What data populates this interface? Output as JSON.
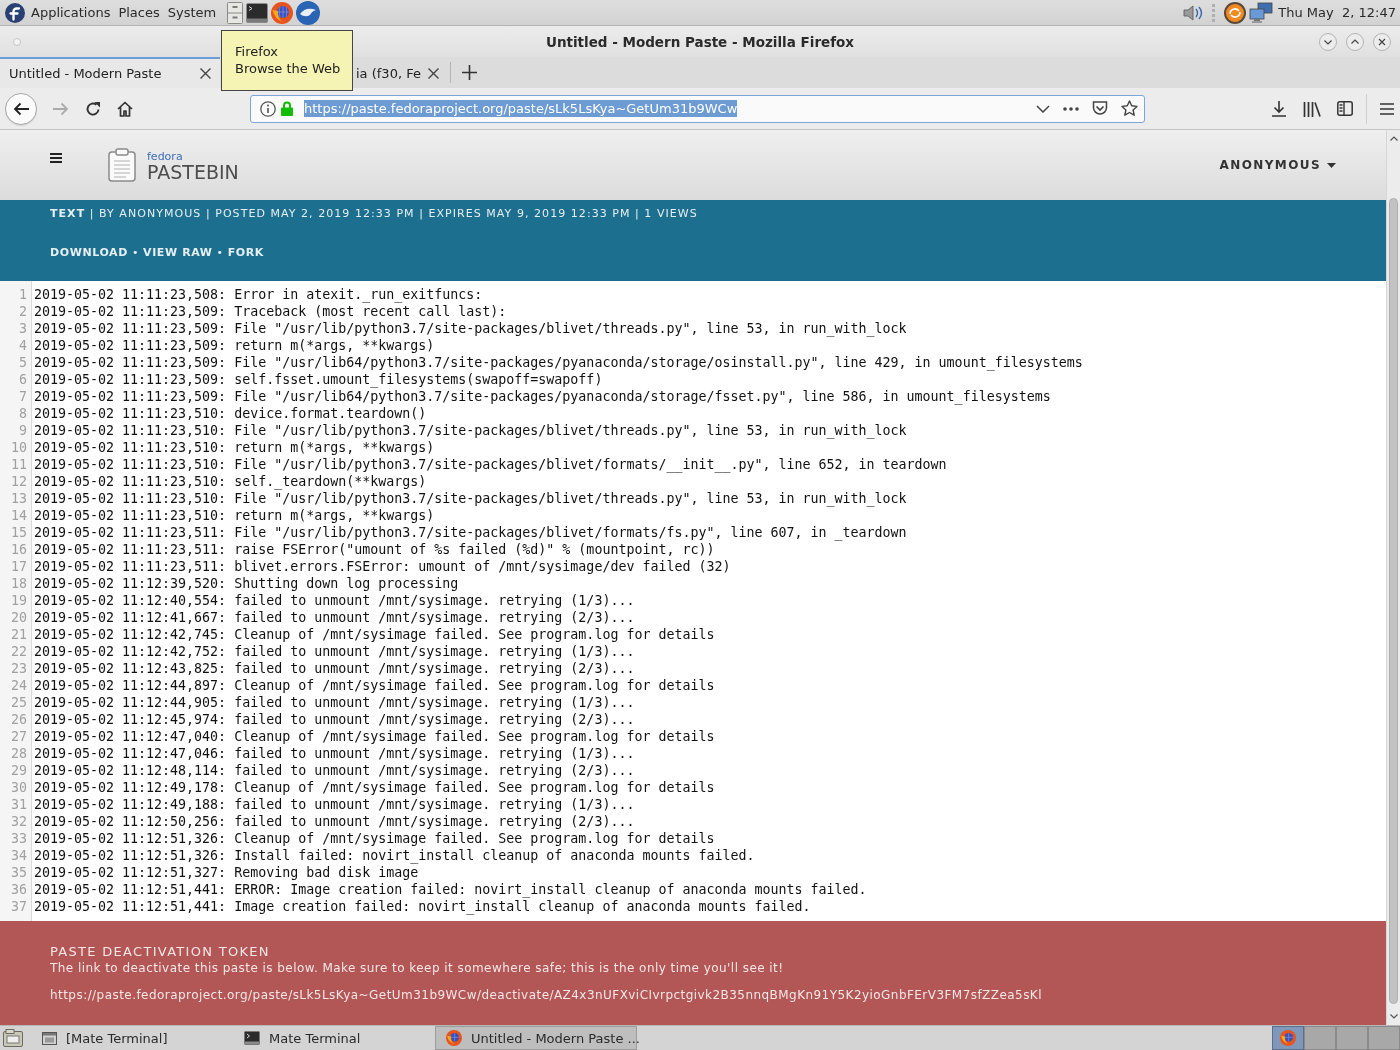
{
  "top_panel": {
    "menus": [
      "Applications",
      "Places",
      "System"
    ],
    "clock": "Thu May  2, 12:47"
  },
  "window": {
    "title": "Untitled - Modern Paste - Mozilla Firefox"
  },
  "tabs": [
    {
      "label": "Untitled - Modern Paste",
      "selected": true
    },
    {
      "label": "ia (f30, Fe",
      "selected": false
    }
  ],
  "tooltip": {
    "title": "Firefox",
    "text": "Browse the Web"
  },
  "navigation": [
    {
      "kind": "back",
      "disabled": false
    },
    {
      "kind": "forward",
      "disabled": true
    },
    {
      "kind": "reload",
      "disabled": false
    },
    {
      "kind": "home",
      "disabled": false
    }
  ],
  "address_bar": {
    "value": "https://paste.fedoraproject.org/paste/sLk5LsKya~GetUm31b9WCw",
    "selected": true
  },
  "page": {
    "header": {
      "brand": "fedora",
      "product": "PASTEBIN",
      "user_menu": "ANONYMOUS"
    },
    "meta": "**TEXT** | BY ANONYMOUS | POSTED MAY 2, 2019 12:33 PM | EXPIRES MAY 9, 2019 12:33 PM | 1 VIEWS",
    "actions": [
      {
        "kind": "link",
        "text": "DOWNLOAD"
      },
      {
        "kind": "separator",
        "text": "•"
      },
      {
        "kind": "link",
        "text": "VIEW RAW"
      },
      {
        "kind": "separator",
        "text": "•"
      },
      {
        "kind": "link",
        "text": "FORK"
      }
    ],
    "lines": [
      {
        "number": "1",
        "text": "2019-05-02 11:11:23,508: Error in atexit._run_exitfuncs:"
      },
      {
        "number": "2",
        "text": "2019-05-02 11:11:23,509: Traceback (most recent call last):"
      },
      {
        "number": "3",
        "text": "2019-05-02 11:11:23,509: File \"/usr/lib/python3.7/site-packages/blivet/threads.py\", line 53, in run_with_lock"
      },
      {
        "number": "4",
        "text": "2019-05-02 11:11:23,509: return m(*args, **kwargs)"
      },
      {
        "number": "5",
        "text": "2019-05-02 11:11:23,509: File \"/usr/lib64/python3.7/site-packages/pyanaconda/storage/osinstall.py\", line 429, in umount_filesystems"
      },
      {
        "number": "6",
        "text": "2019-05-02 11:11:23,509: self.fsset.umount_filesystems(swapoff=swapoff)"
      },
      {
        "number": "7",
        "text": "2019-05-02 11:11:23,509: File \"/usr/lib64/python3.7/site-packages/pyanaconda/storage/fsset.py\", line 586, in umount_filesystems"
      },
      {
        "number": "8",
        "text": "2019-05-02 11:11:23,510: device.format.teardown()"
      },
      {
        "number": "9",
        "text": "2019-05-02 11:11:23,510: File \"/usr/lib/python3.7/site-packages/blivet/threads.py\", line 53, in run_with_lock"
      },
      {
        "number": "10",
        "text": "2019-05-02 11:11:23,510: return m(*args, **kwargs)"
      },
      {
        "number": "11",
        "text": "2019-05-02 11:11:23,510: File \"/usr/lib/python3.7/site-packages/blivet/formats/__init__.py\", line 652, in teardown"
      },
      {
        "number": "12",
        "text": "2019-05-02 11:11:23,510: self._teardown(**kwargs)"
      },
      {
        "number": "13",
        "text": "2019-05-02 11:11:23,510: File \"/usr/lib/python3.7/site-packages/blivet/threads.py\", line 53, in run_with_lock"
      },
      {
        "number": "14",
        "text": "2019-05-02 11:11:23,510: return m(*args, **kwargs)"
      },
      {
        "number": "15",
        "text": "2019-05-02 11:11:23,511: File \"/usr/lib/python3.7/site-packages/blivet/formats/fs.py\", line 607, in _teardown"
      },
      {
        "number": "16",
        "text": "2019-05-02 11:11:23,511: raise FSError(\"umount of %s failed (%d)\" % (mountpoint, rc))"
      },
      {
        "number": "17",
        "text": "2019-05-02 11:11:23,511: blivet.errors.FSError: umount of /mnt/sysimage/dev failed (32)"
      },
      {
        "number": "18",
        "text": "2019-05-02 11:12:39,520: Shutting down log processing"
      },
      {
        "number": "19",
        "text": "2019-05-02 11:12:40,554: failed to unmount /mnt/sysimage. retrying (1/3)..."
      },
      {
        "number": "20",
        "text": "2019-05-02 11:12:41,667: failed to unmount /mnt/sysimage. retrying (2/3)..."
      },
      {
        "number": "21",
        "text": "2019-05-02 11:12:42,745: Cleanup of /mnt/sysimage failed. See program.log for details"
      },
      {
        "number": "22",
        "text": "2019-05-02 11:12:42,752: failed to unmount /mnt/sysimage. retrying (1/3)..."
      },
      {
        "number": "23",
        "text": "2019-05-02 11:12:43,825: failed to unmount /mnt/sysimage. retrying (2/3)..."
      },
      {
        "number": "24",
        "text": "2019-05-02 11:12:44,897: Cleanup of /mnt/sysimage failed. See program.log for details"
      },
      {
        "number": "25",
        "text": "2019-05-02 11:12:44,905: failed to unmount /mnt/sysimage. retrying (1/3)..."
      },
      {
        "number": "26",
        "text": "2019-05-02 11:12:45,974: failed to unmount /mnt/sysimage. retrying (2/3)..."
      },
      {
        "number": "27",
        "text": "2019-05-02 11:12:47,040: Cleanup of /mnt/sysimage failed. See program.log for details"
      },
      {
        "number": "28",
        "text": "2019-05-02 11:12:47,046: failed to unmount /mnt/sysimage. retrying (1/3)..."
      },
      {
        "number": "29",
        "text": "2019-05-02 11:12:48,114: failed to unmount /mnt/sysimage. retrying (2/3)..."
      },
      {
        "number": "30",
        "text": "2019-05-02 11:12:49,178: Cleanup of /mnt/sysimage failed. See program.log for details"
      },
      {
        "number": "31",
        "text": "2019-05-02 11:12:49,188: failed to unmount /mnt/sysimage. retrying (1/3)..."
      },
      {
        "number": "32",
        "text": "2019-05-02 11:12:50,256: failed to unmount /mnt/sysimage. retrying (2/3)..."
      },
      {
        "number": "33",
        "text": "2019-05-02 11:12:51,326: Cleanup of /mnt/sysimage failed. See program.log for details"
      },
      {
        "number": "34",
        "text": "2019-05-02 11:12:51,326: Install failed: novirt_install cleanup of anaconda mounts failed."
      },
      {
        "number": "35",
        "text": "2019-05-02 11:12:51,327: Removing bad disk image"
      },
      {
        "number": "36",
        "text": "2019-05-02 11:12:51,441: ERROR: Image creation failed: novirt_install cleanup of anaconda mounts failed."
      },
      {
        "number": "37",
        "text": "2019-05-02 11:12:51,441: Image creation failed: novirt_install cleanup of anaconda mounts failed."
      }
    ],
    "deactivation": {
      "title": "PASTE DEACTIVATION TOKEN",
      "text": "The link to deactivate this paste is below. Make sure to keep it somewhere safe; this is the only time you'll see it!",
      "url": "https://paste.fedoraproject.org/paste/sLk5LsKya~GetUm31b9WCw/deactivate/AZ4x3nUFXviCIvrpctgivk2B35nnqBMgKn91Y5K2yioGnbFErV3FM7sfZZea5sKl"
    }
  },
  "taskbar": {
    "tasks": [
      {
        "kind": "window",
        "label": "[Mate Terminal]",
        "selected": false
      },
      {
        "kind": "terminal",
        "label": "Mate Terminal",
        "selected": false
      },
      {
        "kind": "browser",
        "label": "Untitled - Modern Paste ...",
        "selected": true
      }
    ],
    "workspaces": [
      {
        "selected": true
      },
      {
        "selected": false
      },
      {
        "selected": false
      },
      {
        "selected": false
      }
    ]
  }
}
